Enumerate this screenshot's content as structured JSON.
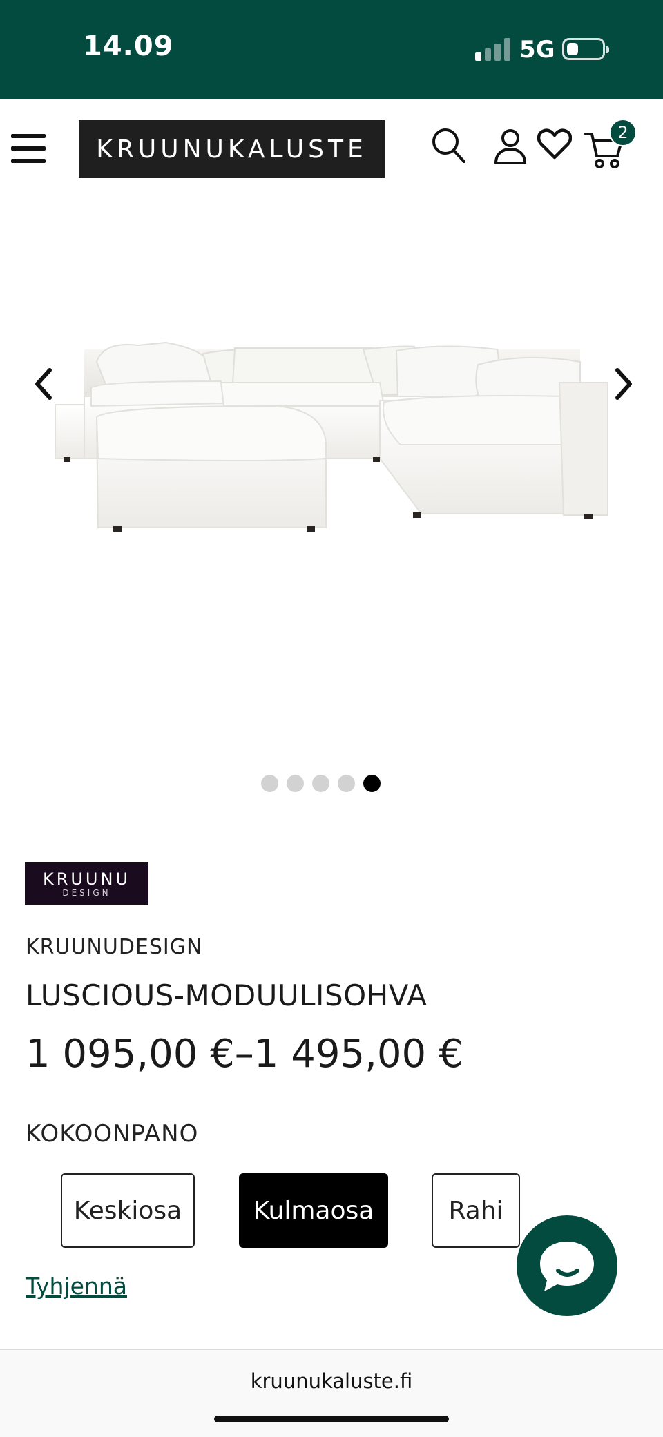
{
  "status_bar": {
    "time": "14.09",
    "network": "5G",
    "background_color": "#034a3f"
  },
  "header": {
    "menu_icon": "hamburger-menu-icon",
    "logo_text": "KRUUNUKALUSTE",
    "icons": [
      "search-icon",
      "user-icon",
      "heart-icon",
      "cart-icon"
    ],
    "cart_count": "2"
  },
  "gallery": {
    "image_alt": "white modular corner sofa with ottoman",
    "slide_count": 5,
    "active_slide": 5
  },
  "product": {
    "brand_logo": {
      "line1": "KRUUNU",
      "line2": "DESIGN"
    },
    "brand_name": "KRUUNUDESIGN",
    "title": "LUSCIOUS-MODUULISOHVA",
    "price_range": "1 095,00 €–1 495,00 €",
    "option_label": "KOKOONPANO",
    "options": [
      {
        "label": "Keskiosa",
        "selected": false
      },
      {
        "label": "Kulmaosa",
        "selected": true
      },
      {
        "label": "Rahi",
        "selected": false
      }
    ],
    "clear_label": "Tyhjennä"
  },
  "chat": {
    "icon": "chat-bubble-icon"
  },
  "browser": {
    "url": "kruunukaluste.fi"
  },
  "colors": {
    "brand_green": "#034a3f",
    "brand_logo_bg": "#1a0b1f",
    "selected_option": "#000000"
  }
}
